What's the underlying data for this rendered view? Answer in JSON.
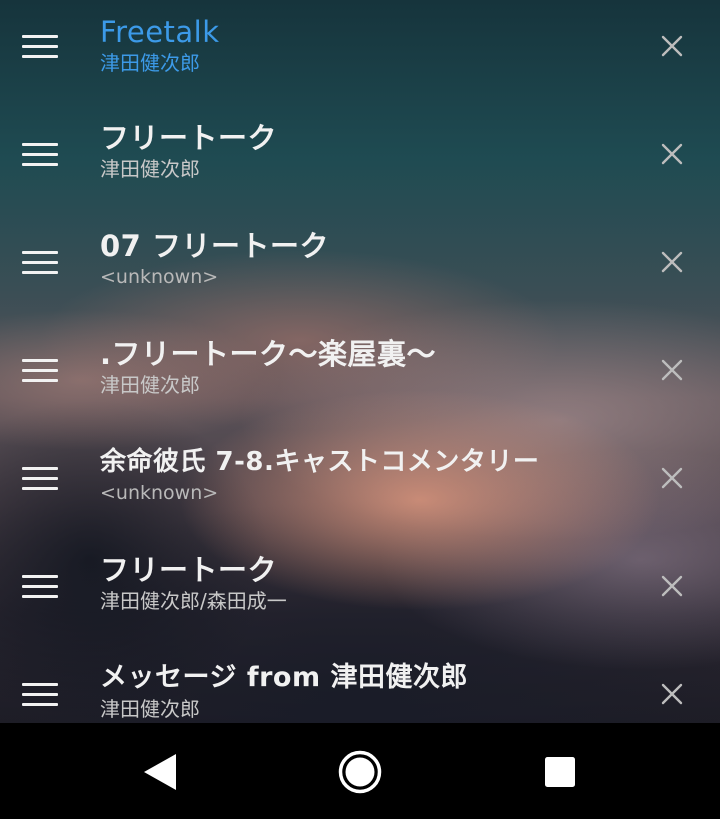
{
  "playlist": {
    "items": [
      {
        "title": "Freetalk",
        "subtitle": "津田健次郎",
        "active": true
      },
      {
        "title": "フリートーク",
        "subtitle": "津田健次郎",
        "active": false
      },
      {
        "title": "07 フリートーク",
        "subtitle": "<unknown>",
        "active": false
      },
      {
        "title": ".フリートーク～楽屋裏～",
        "subtitle": "津田健次郎",
        "active": false
      },
      {
        "title": "余命彼氏 7-8.キャストコメンタリー",
        "subtitle": "<unknown>",
        "active": false
      },
      {
        "title": "フリートーク",
        "subtitle": "津田健次郎/森田成一",
        "active": false
      },
      {
        "title": "メッセージ from 津田健次郎",
        "subtitle": "津田健次郎",
        "active": false
      }
    ],
    "icons": {
      "drag": "drag-handle-icon",
      "remove": "close-icon"
    },
    "colors": {
      "active_text": "#3c9ae8",
      "title_text": "#f1f1f1",
      "subtitle_text": "#c8c8c8",
      "remove_icon": "#bdbdbd"
    }
  },
  "navbar": {
    "back_icon": "back-triangle-icon",
    "home_icon": "home-circle-icon",
    "recents_icon": "recents-square-icon"
  }
}
